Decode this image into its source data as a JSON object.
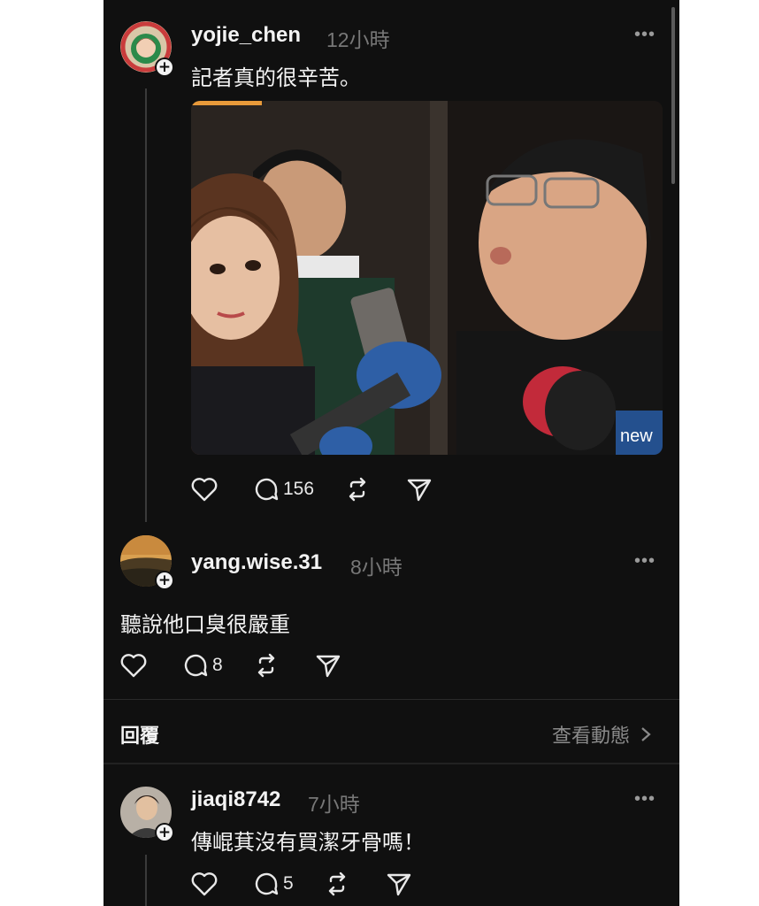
{
  "posts": [
    {
      "username": "yojie_chen",
      "time": "12小時",
      "more": "•••",
      "text": "記者真的很辛苦。",
      "actions": {
        "comments": "156"
      },
      "image_logo": "new 新聞"
    },
    {
      "username": "yang.wise.31",
      "time": "8小時",
      "more": "•••",
      "text": "聽說他口臭很嚴重",
      "actions": {
        "comments": "8"
      }
    },
    {
      "username": "jiaqi8742",
      "time": "7小時",
      "more": "•••",
      "text": "傳崐萁沒有買潔牙骨嗎！",
      "actions": {
        "comments": "5"
      }
    }
  ],
  "reply_bar": {
    "label": "回覆",
    "view_activity": "查看動態"
  },
  "colors": {
    "background": "#101010",
    "text": "#f3f3f3",
    "muted": "#777777",
    "divider": "#2a2a2a"
  },
  "icons": [
    "heart-icon",
    "comment-icon",
    "repost-icon",
    "share-icon",
    "more-icon",
    "follow-plus-icon",
    "chevron-right-icon"
  ]
}
